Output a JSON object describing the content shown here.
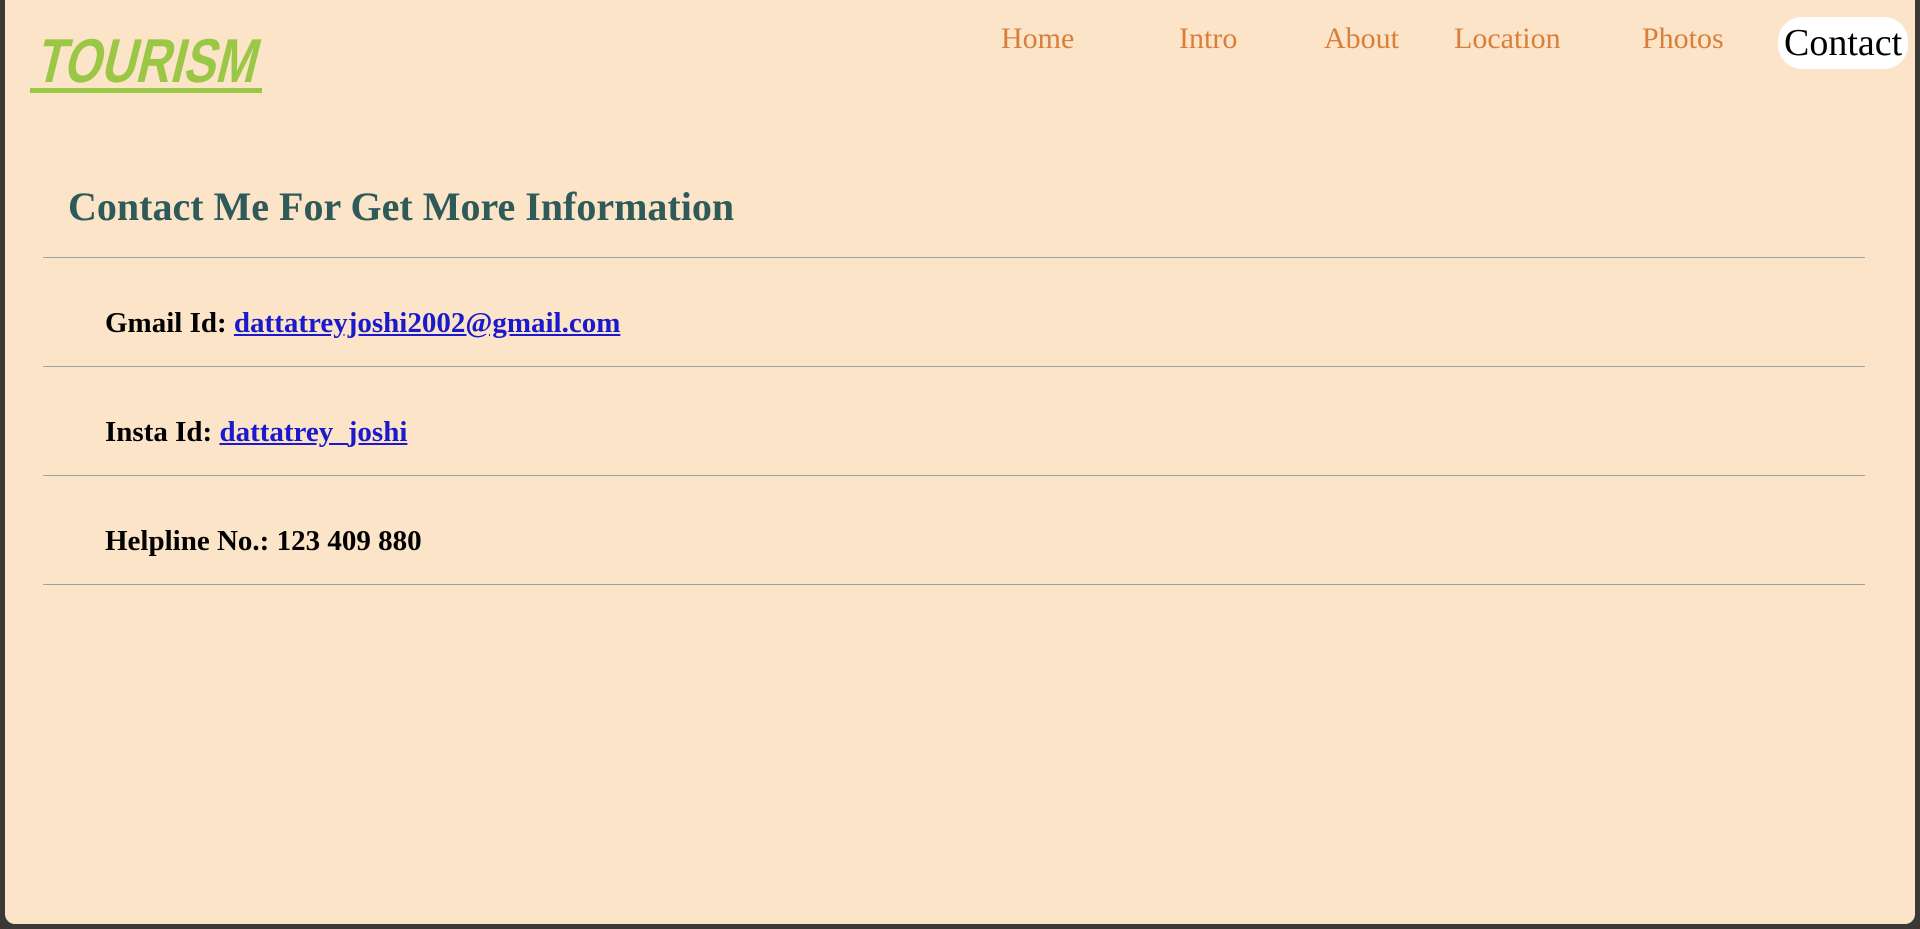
{
  "brand": {
    "logo_text": "TOURISM",
    "logo_color": "#9bc746"
  },
  "nav": {
    "items": [
      {
        "label": "Home"
      },
      {
        "label": "Intro"
      },
      {
        "label": "About"
      },
      {
        "label": "Location"
      },
      {
        "label": "Photos"
      },
      {
        "label": "Contact",
        "active": true
      }
    ],
    "color": "#d97f3b"
  },
  "contact": {
    "heading": "Contact Me For Get More Information",
    "gmail": {
      "label": "Gmail Id:",
      "value": "dattatreyjoshi2002@gmail.com"
    },
    "insta": {
      "label": "Insta Id:",
      "value": "dattatrey_joshi"
    },
    "helpline": {
      "label": "Helpline No.:",
      "value": "123 409 880"
    }
  },
  "colors": {
    "background": "#fbe4c8",
    "heading": "#2f5a5a",
    "link": "#1a1acc"
  }
}
